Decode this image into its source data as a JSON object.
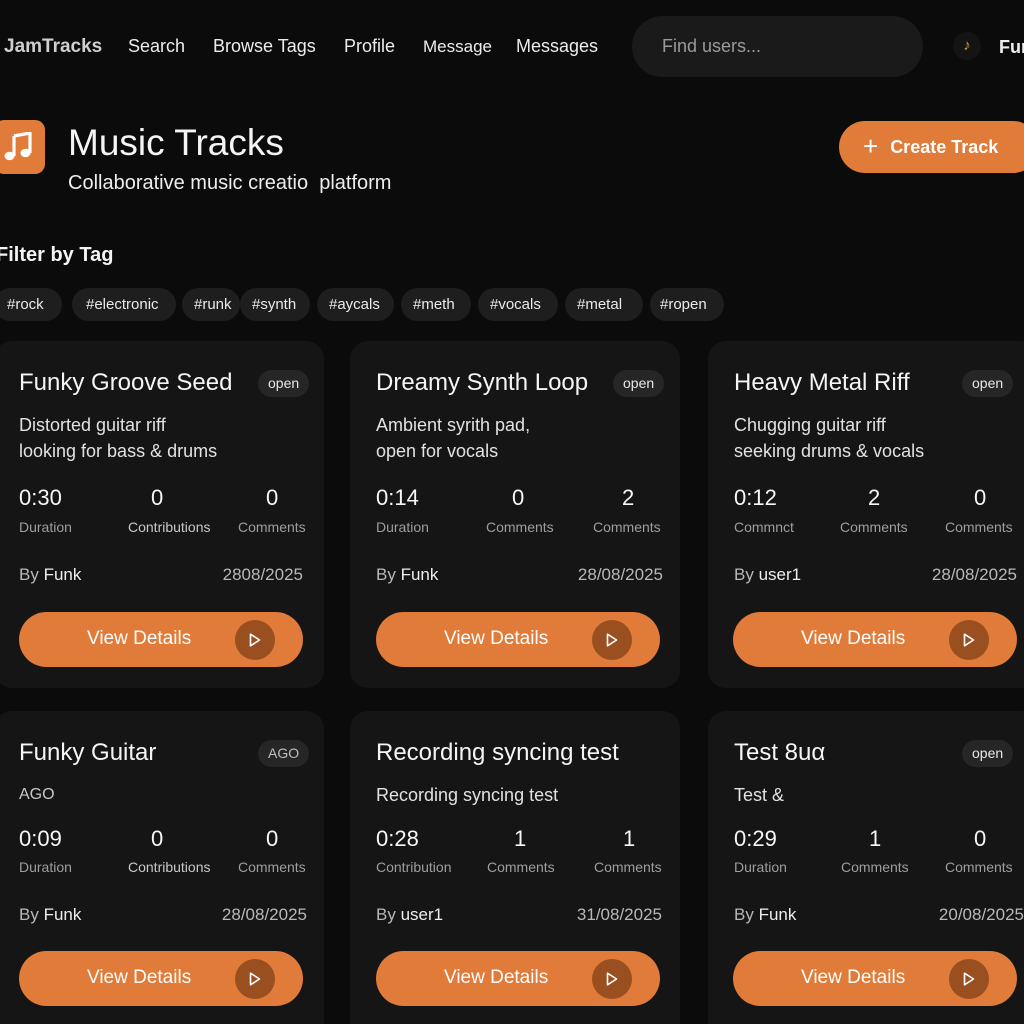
{
  "nav": {
    "brand": "JamTracks",
    "links": [
      "Search",
      "Browse Tags",
      "Profile",
      "Message",
      "Messages"
    ],
    "search_placeholder": "Find users...",
    "user_avatar_icon": "music-note-icon",
    "user_name": "Fur"
  },
  "header": {
    "title": "Music Tracks",
    "subtitle": "Collaborative music creatio  platform",
    "create_button": "Create Track",
    "logo_icon": "music-note-icon"
  },
  "filter": {
    "title": "Filter by Tag",
    "tags": [
      "#rock",
      "#electronic",
      "#runk",
      "#synth",
      "#aycals",
      "#meth",
      "#vocals",
      "#metal",
      "#ropen"
    ]
  },
  "cards": [
    {
      "title": "Funky Groove Seed",
      "badge": "open",
      "description": "Distorted guitar riff\nlooking for bass & drums",
      "stats": [
        {
          "value": "0:30",
          "label": "Duration"
        },
        {
          "value": "0",
          "label": "Contributions"
        },
        {
          "value": "0",
          "label": "Comments"
        }
      ],
      "by": "By",
      "author": "Funk",
      "date": "2808/2025",
      "button": "View Details"
    },
    {
      "title": "Dreamy Synth Loop",
      "badge": "open",
      "description": "Ambient syrith pad,\nopen for vocals",
      "stats": [
        {
          "value": "0:14",
          "label": "Duration"
        },
        {
          "value": "0",
          "label": "Comments"
        },
        {
          "value": "2",
          "label": "Comments"
        }
      ],
      "by": "By",
      "author": "Funk",
      "date": "28/08/2025",
      "button": "View Details"
    },
    {
      "title": "Heavy Metal Riff",
      "badge": "open",
      "description": "Chugging guitar riff\nseeking drums & vocals",
      "stats": [
        {
          "value": "0:12",
          "label": "Commnct"
        },
        {
          "value": "2",
          "label": "Comments"
        },
        {
          "value": "0",
          "label": "Comments"
        }
      ],
      "by": "By",
      "author": "user1",
      "date": "28/08/2025",
      "button": "View Details"
    },
    {
      "title": "Funky Guitar",
      "badge": "AGO",
      "description": "AGO",
      "stats": [
        {
          "value": "0:09",
          "label": "Duration"
        },
        {
          "value": "0",
          "label": "Contributions"
        },
        {
          "value": "0",
          "label": "Comments"
        }
      ],
      "by": "By",
      "author": "Funk",
      "date": "28/08/2025",
      "button": "View Details"
    },
    {
      "title": "Recording syncing test",
      "badge": "",
      "description": "Recording syncing test",
      "stats": [
        {
          "value": "0:28",
          "label": "Contribution"
        },
        {
          "value": "1",
          "label": "Comments"
        },
        {
          "value": "1",
          "label": "Comments"
        }
      ],
      "by": "By",
      "author": "user1",
      "date": "31/08/2025",
      "button": "View Details"
    },
    {
      "title": "Test 8uα",
      "badge": "open",
      "description": "Test &",
      "stats": [
        {
          "value": "0:29",
          "label": "Duration"
        },
        {
          "value": "1",
          "label": "Comments"
        },
        {
          "value": "0",
          "label": "Comments"
        }
      ],
      "by": "By",
      "author": "Funk",
      "date": "20/08/2025",
      "button": "View Details"
    }
  ],
  "colors": {
    "accent": "#e07b39",
    "background": "#0b0b0b",
    "card": "#151515"
  }
}
